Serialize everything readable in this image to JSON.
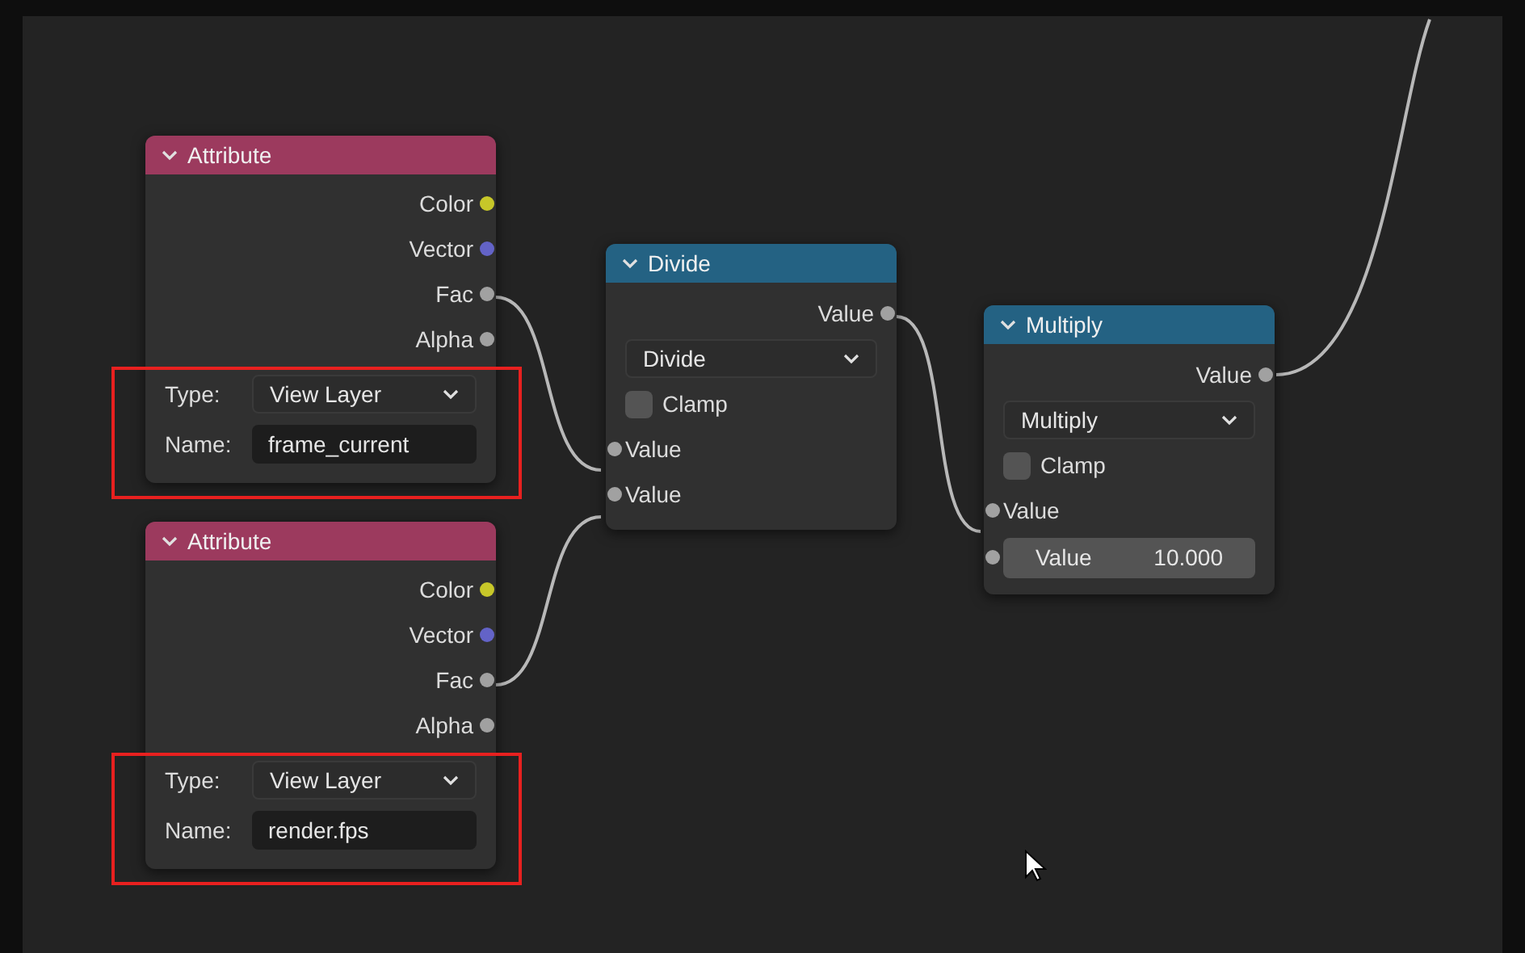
{
  "nodes": [
    {
      "title": "Attribute",
      "color": "#9c3a5e",
      "highlighted": true,
      "rows": [
        {
          "kind": "output",
          "label": "Color",
          "color": "#c7c729"
        },
        {
          "kind": "output",
          "label": "Vector",
          "color": "#6363c7"
        },
        {
          "kind": "output",
          "label": "Fac",
          "color": "#a1a1a1"
        },
        {
          "kind": "output",
          "label": "Alpha",
          "color": "#a1a1a1"
        },
        {
          "kind": "dropdown",
          "label": "Type:",
          "value": "View Layer"
        },
        {
          "kind": "field",
          "label": "Name:",
          "value": "frame_current"
        }
      ]
    },
    {
      "title": "Attribute",
      "color": "#9c3a5e",
      "highlighted": true,
      "rows": [
        {
          "kind": "output",
          "label": "Color",
          "color": "#c7c729"
        },
        {
          "kind": "output",
          "label": "Vector",
          "color": "#6363c7"
        },
        {
          "kind": "output",
          "label": "Fac",
          "color": "#a1a1a1"
        },
        {
          "kind": "output",
          "label": "Alpha",
          "color": "#a1a1a1"
        },
        {
          "kind": "dropdown",
          "label": "Type:",
          "value": "View Layer"
        },
        {
          "kind": "field",
          "label": "Name:",
          "value": "render.fps"
        }
      ]
    },
    {
      "title": "Divide",
      "color": "#246283",
      "rows": [
        {
          "kind": "output",
          "label": "Value",
          "color": "#a1a1a1"
        },
        {
          "kind": "dropdown",
          "value": "Divide"
        },
        {
          "kind": "checkbox",
          "label": "Clamp",
          "checked": false
        },
        {
          "kind": "input",
          "label": "Value",
          "color": "#a1a1a1"
        },
        {
          "kind": "input",
          "label": "Value",
          "color": "#a1a1a1"
        }
      ]
    },
    {
      "title": "Multiply",
      "color": "#246283",
      "rows": [
        {
          "kind": "output",
          "label": "Value",
          "color": "#a1a1a1"
        },
        {
          "kind": "dropdown",
          "value": "Multiply"
        },
        {
          "kind": "checkbox",
          "label": "Clamp",
          "checked": false
        },
        {
          "kind": "input",
          "label": "Value",
          "color": "#a1a1a1"
        },
        {
          "kind": "number",
          "label": "Value",
          "value": "10.000",
          "color": "#a1a1a1"
        }
      ]
    }
  ]
}
